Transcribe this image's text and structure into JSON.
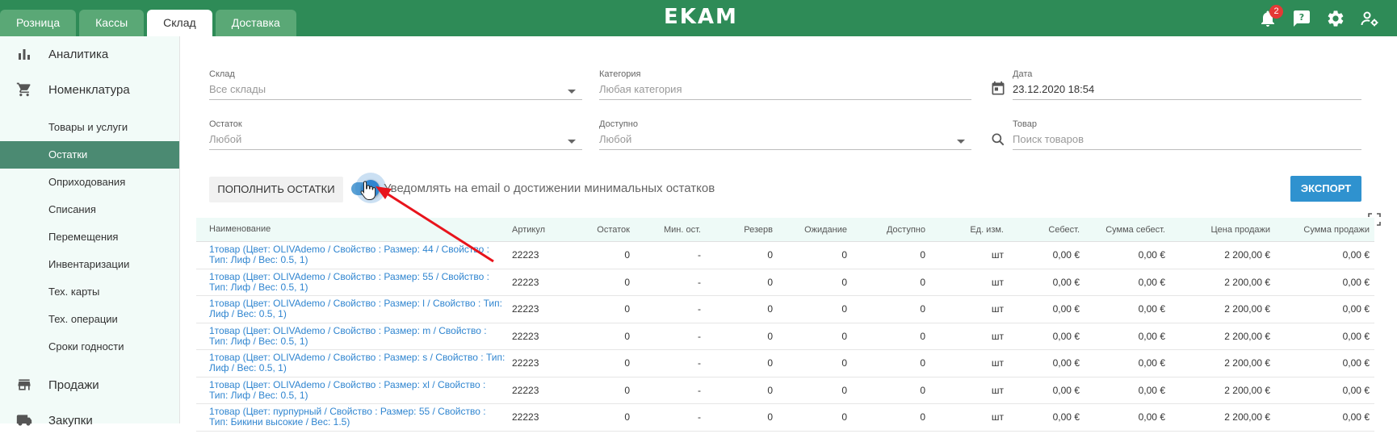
{
  "header": {
    "tabs": [
      "Розница",
      "Кассы",
      "Склад",
      "Доставка"
    ],
    "active_tab": "Склад",
    "logo": "EKAM",
    "notifications_count": "2"
  },
  "sidebar": {
    "sections": [
      {
        "label": "Аналитика",
        "icon": "bar-chart-icon"
      },
      {
        "label": "Номенклатура",
        "icon": "cart-icon"
      }
    ],
    "sub_items": [
      "Товары и услуги",
      "Остатки",
      "Оприходования",
      "Списания",
      "Перемещения",
      "Инвентаризации",
      "Тех. карты",
      "Тех. операции",
      "Сроки годности"
    ],
    "active_item": "Остатки",
    "bottom_sections": [
      {
        "label": "Продажи",
        "icon": "store-icon"
      },
      {
        "label": "Закупки",
        "icon": "truck-icon"
      }
    ]
  },
  "filters": {
    "warehouse": {
      "label": "Склад",
      "value": "Все склады"
    },
    "category": {
      "label": "Категория",
      "value": "Любая категория"
    },
    "date": {
      "label": "Дата",
      "value": "23.12.2020 18:54"
    },
    "remainder": {
      "label": "Остаток",
      "value": "Любой"
    },
    "available": {
      "label": "Доступно",
      "value": "Любой"
    },
    "product": {
      "label": "Товар",
      "placeholder": "Поиск товаров"
    }
  },
  "actions": {
    "replenish_label": "ПОПОЛНИТЬ ОСТАТКИ",
    "notify_label": "Уведомлять на email о достижении минимальных остатков",
    "notify_enabled": true,
    "export_label": "ЭКСПОРТ"
  },
  "table": {
    "columns": [
      "Наименование",
      "Артикул",
      "Остаток",
      "Мин. ост.",
      "Резерв",
      "Ожидание",
      "Доступно",
      "Ед. изм.",
      "Себест.",
      "Сумма себест.",
      "Цена продажи",
      "Сумма продажи"
    ],
    "rows": [
      [
        "1товар (Цвет: OLIVAdemo / Свойство : Размер: 44 / Свойство : Тип: Лиф / Вес: 0.5, 1)",
        "22223",
        "0",
        "-",
        "0",
        "0",
        "0",
        "шт",
        "0,00 €",
        "0,00 €",
        "2 200,00 €",
        "0,00 €"
      ],
      [
        "1товар (Цвет: OLIVAdemo / Свойство : Размер: 55 / Свойство : Тип: Лиф / Вес: 0.5, 1)",
        "22223",
        "0",
        "-",
        "0",
        "0",
        "0",
        "шт",
        "0,00 €",
        "0,00 €",
        "2 200,00 €",
        "0,00 €"
      ],
      [
        "1товар (Цвет: OLIVAdemo / Свойство : Размер: l / Свойство : Тип: Лиф / Вес: 0.5, 1)",
        "22223",
        "0",
        "-",
        "0",
        "0",
        "0",
        "шт",
        "0,00 €",
        "0,00 €",
        "2 200,00 €",
        "0,00 €"
      ],
      [
        "1товар (Цвет: OLIVAdemo / Свойство : Размер: m / Свойство : Тип: Лиф / Вес: 0.5, 1)",
        "22223",
        "0",
        "-",
        "0",
        "0",
        "0",
        "шт",
        "0,00 €",
        "0,00 €",
        "2 200,00 €",
        "0,00 €"
      ],
      [
        "1товар (Цвет: OLIVAdemo / Свойство : Размер: s / Свойство : Тип: Лиф / Вес: 0.5, 1)",
        "22223",
        "0",
        "-",
        "0",
        "0",
        "0",
        "шт",
        "0,00 €",
        "0,00 €",
        "2 200,00 €",
        "0,00 €"
      ],
      [
        "1товар (Цвет: OLIVAdemo / Свойство : Размер: xl / Свойство : Тип: Лиф / Вес: 0.5, 1)",
        "22223",
        "0",
        "-",
        "0",
        "0",
        "0",
        "шт",
        "0,00 €",
        "0,00 €",
        "2 200,00 €",
        "0,00 €"
      ],
      [
        "1товар (Цвет: пурпурный / Свойство : Размер: 55 / Свойство : Тип: Бикини высокие / Вес: 1.5)",
        "22223",
        "0",
        "-",
        "0",
        "0",
        "0",
        "шт",
        "0,00 €",
        "0,00 €",
        "2 200,00 €",
        "0,00 €"
      ]
    ]
  },
  "colors": {
    "brand_green": "#2e8b57",
    "tab_inactive": "#5aa876",
    "sidebar_active": "#4b8a72",
    "link_blue": "#2f85d0",
    "export_blue": "#2f92cf",
    "annotation_red": "#e8141c"
  }
}
